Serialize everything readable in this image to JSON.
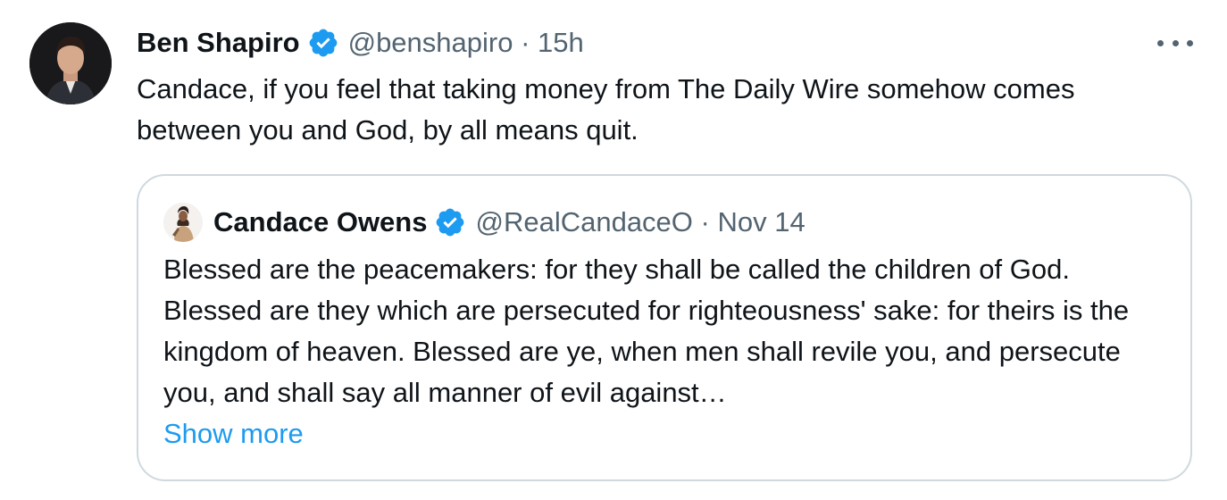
{
  "tweet": {
    "author": {
      "name": "Ben Shapiro",
      "handle": "@benshapiro",
      "time": "15h",
      "separator": "·"
    },
    "text": "Candace, if you feel that taking money from The Daily Wire somehow comes between you and God, by all means quit.",
    "more_icon": "more-horizontal-icon",
    "verified_icon": "verified-badge-icon"
  },
  "quote": {
    "author": {
      "name": "Candace Owens",
      "handle": "@RealCandaceO",
      "time": "Nov 14",
      "separator": "·"
    },
    "text": "Blessed are the peacemakers: for they shall be called the children of God. Blessed are they which are persecuted for righteousness' sake: for theirs is the kingdom of heaven. Blessed are ye, when men shall revile you, and persecute you, and shall say all manner of evil against…",
    "show_more": "Show more"
  },
  "colors": {
    "text_primary": "#0f1419",
    "text_secondary": "#536471",
    "accent": "#1d9bf0",
    "border": "#cfd9de",
    "background": "#ffffff"
  }
}
